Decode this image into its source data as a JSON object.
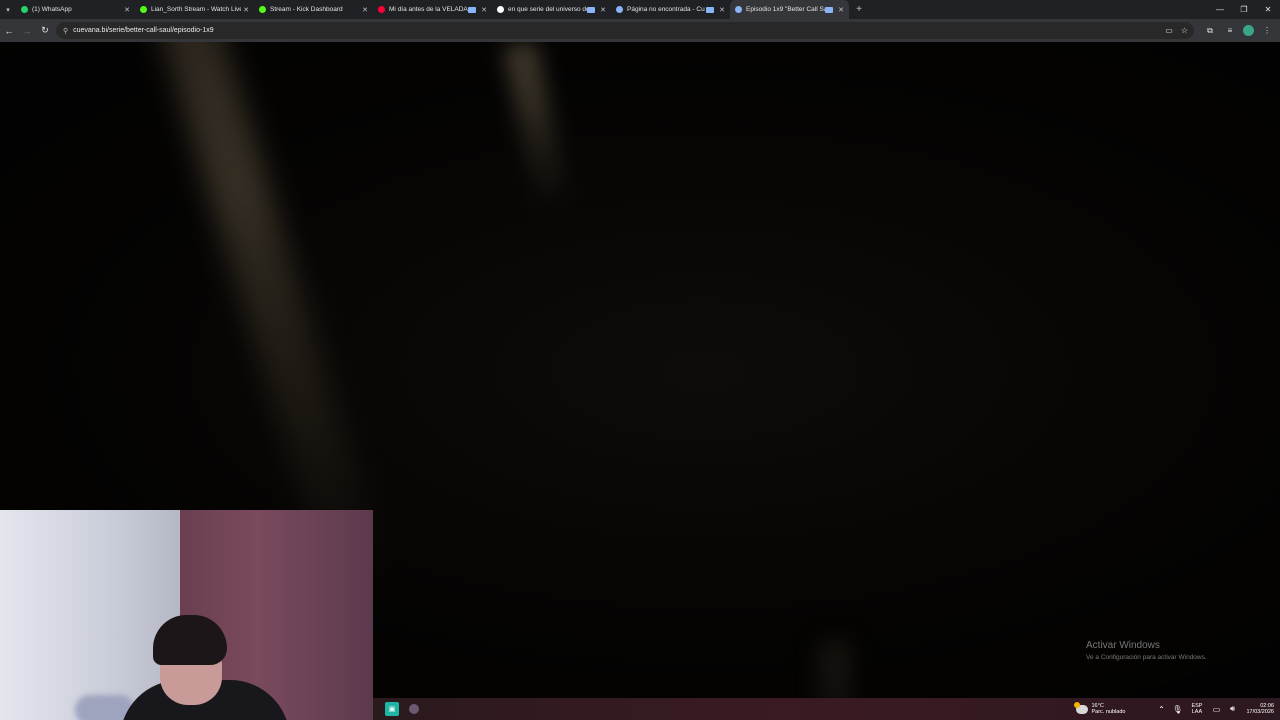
{
  "browser": {
    "tabs": [
      {
        "title": "(1) WhatsApp",
        "favicon": "whatsapp-icon",
        "color": "#25d366",
        "active": false
      },
      {
        "title": "Lian_Sorth Stream - Watch Live",
        "favicon": "kick-icon",
        "color": "#53fc18",
        "active": false
      },
      {
        "title": "Stream - Kick Dashboard",
        "favicon": "kick-icon",
        "color": "#53fc18",
        "active": false
      },
      {
        "title": "Mi día antes de la VELADA",
        "favicon": "youtube-icon",
        "color": "#ff0033",
        "active": false
      },
      {
        "title": "en que serie del universo de b",
        "favicon": "google-icon",
        "color": "#ffffff",
        "active": false
      },
      {
        "title": "Página no encontrada - Cu",
        "favicon": "globe-icon",
        "color": "#8ab4f8",
        "active": false
      },
      {
        "title": "Episodio 1x9 \"Better Call Sa",
        "favicon": "globe-icon",
        "color": "#8ab4f8",
        "active": true
      }
    ],
    "new_tab_label": "+",
    "url": "cuevana.bi/serie/better-call-saul/episodio-1x9"
  },
  "overlay": {
    "activate_title": "Activar Windows",
    "activate_sub": "Ve a Configuración para activar Windows."
  },
  "taskbar": {
    "weather_temp": "16°C",
    "weather_desc": "Parc. nublado",
    "lang_top": "ESP",
    "lang_bottom": "LAA",
    "time": "02:06",
    "date": "17/03/2026"
  }
}
